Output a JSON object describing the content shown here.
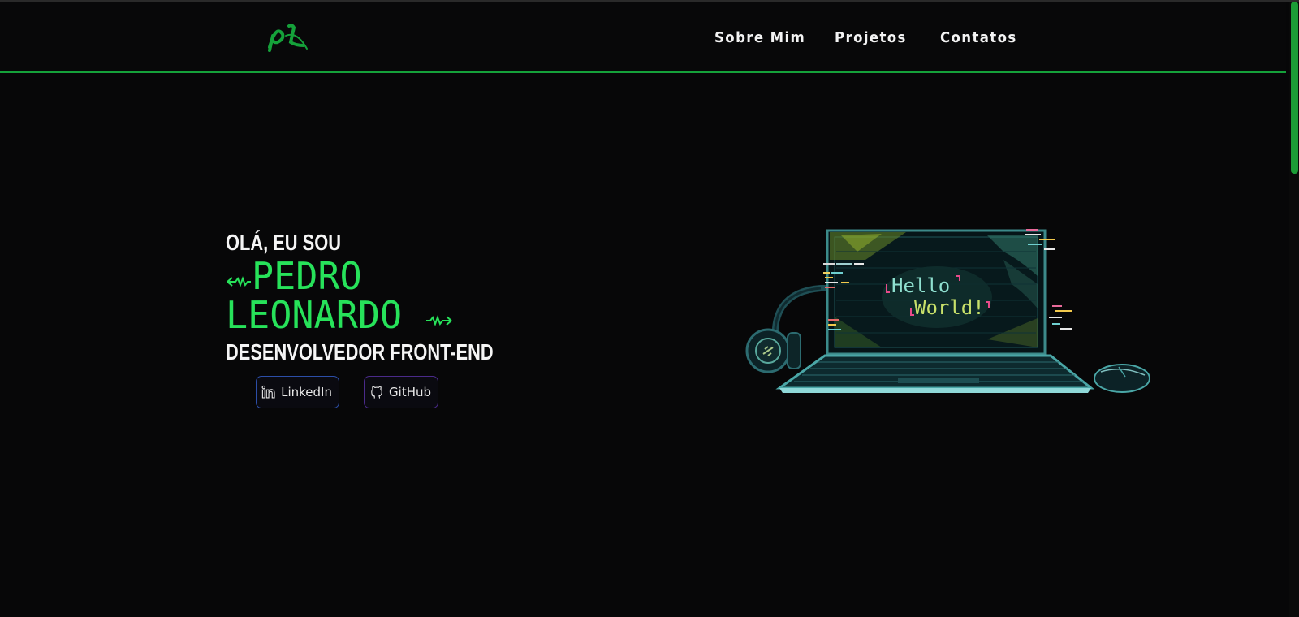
{
  "nav": {
    "logo_alt": "pL",
    "links": [
      "Sobre Mim",
      "Projetos",
      "Contatos"
    ]
  },
  "hero": {
    "greeting": "OLÁ, EU SOU",
    "name_first": "PEDRO",
    "name_last": "LEONARDO",
    "role": "DESENVOLVEDOR FRONT-END"
  },
  "social": {
    "linkedin_label": "LinkedIn",
    "github_label": "GitHub"
  },
  "illustration": {
    "screen_line1": "Hello",
    "screen_line2": "World!"
  },
  "colors": {
    "accent": "#27e25a",
    "nav_border": "#15a13a",
    "background": "#070708",
    "text": "#f5f5f5"
  }
}
